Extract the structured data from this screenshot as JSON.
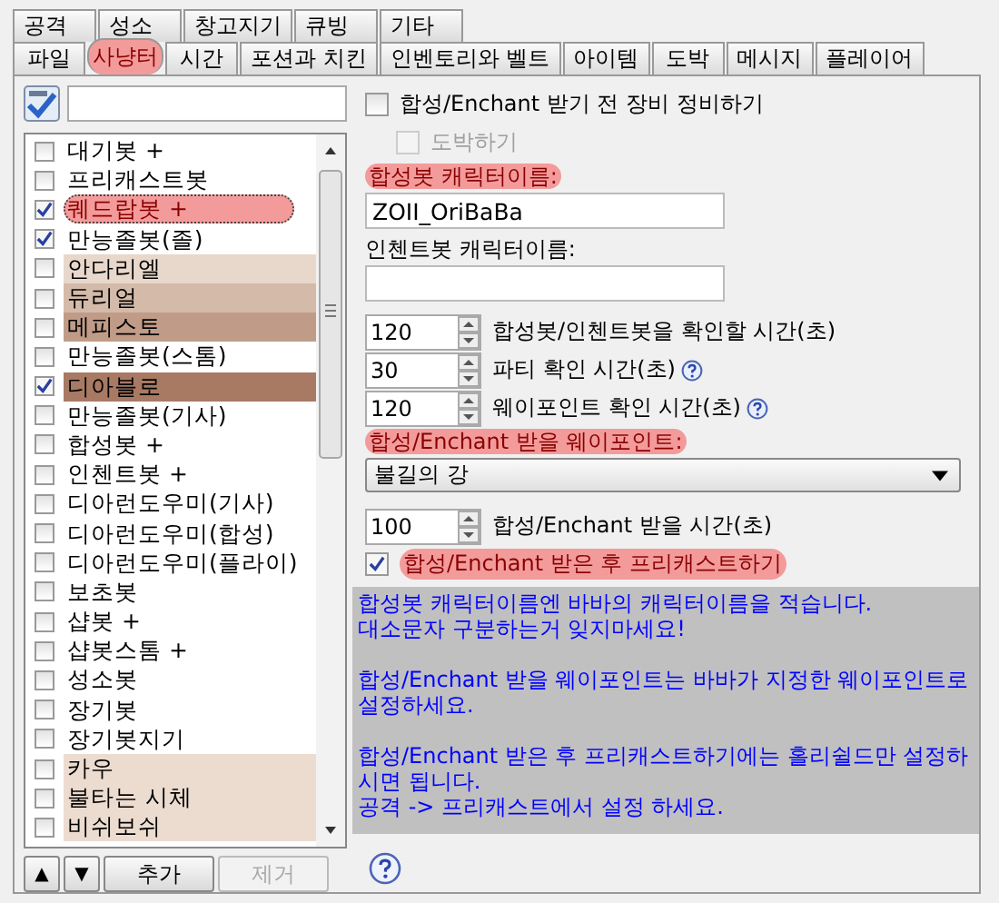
{
  "tabs_back": [
    {
      "label": "공격",
      "selected": false
    },
    {
      "label": "성소",
      "selected": false
    },
    {
      "label": "창고지기",
      "selected": false
    },
    {
      "label": "큐빙",
      "selected": false
    },
    {
      "label": "기타",
      "selected": false
    }
  ],
  "tabs_front": [
    {
      "label": "파일",
      "selected": false,
      "annotated": false
    },
    {
      "label": "사냥터",
      "selected": true,
      "annotated": true
    },
    {
      "label": "시간",
      "selected": false,
      "annotated": false
    },
    {
      "label": "포션과 치킨",
      "selected": false,
      "annotated": false
    },
    {
      "label": "인벤토리와 벨트",
      "selected": false,
      "annotated": false
    },
    {
      "label": "아이템",
      "selected": false,
      "annotated": false
    },
    {
      "label": "도박",
      "selected": false,
      "annotated": false
    },
    {
      "label": "메시지",
      "selected": false,
      "annotated": false
    },
    {
      "label": "플레이어",
      "selected": false,
      "annotated": false
    }
  ],
  "areas": [
    {
      "label": "대기봇 +",
      "checked": false,
      "selected": false,
      "annotated": false
    },
    {
      "label": "프리캐스트봇",
      "checked": false,
      "selected": false,
      "annotated": false
    },
    {
      "label": "퀘드랍봇 +",
      "checked": true,
      "selected": true,
      "annotated": true
    },
    {
      "label": "만능졸봇(졸)",
      "checked": true,
      "selected": false,
      "annotated": false
    },
    {
      "label": "안다리엘",
      "checked": false,
      "selected": false,
      "annotated": false,
      "color": "#e8d8cc"
    },
    {
      "label": "듀리얼",
      "checked": false,
      "selected": false,
      "annotated": false,
      "color": "#d4baa9"
    },
    {
      "label": "메피스토",
      "checked": false,
      "selected": false,
      "annotated": false,
      "color": "#c09c88"
    },
    {
      "label": "만능졸봇(스톰)",
      "checked": false,
      "selected": false,
      "annotated": false
    },
    {
      "label": "디아블로",
      "checked": true,
      "selected": false,
      "annotated": false,
      "color": "#a87a64"
    },
    {
      "label": "만능졸봇(기사)",
      "checked": false,
      "selected": false,
      "annotated": false
    },
    {
      "label": "합성봇 +",
      "checked": false,
      "selected": false,
      "annotated": false
    },
    {
      "label": "인첸트봇 +",
      "checked": false,
      "selected": false,
      "annotated": false
    },
    {
      "label": "디아런도우미(기사)",
      "checked": false,
      "selected": false,
      "annotated": false
    },
    {
      "label": "디아런도우미(합성)",
      "checked": false,
      "selected": false,
      "annotated": false
    },
    {
      "label": "디아런도우미(플라이)",
      "checked": false,
      "selected": false,
      "annotated": false
    },
    {
      "label": "보초봇",
      "checked": false,
      "selected": false,
      "annotated": false
    },
    {
      "label": "샵봇 +",
      "checked": false,
      "selected": false,
      "annotated": false
    },
    {
      "label": "샵봇스톰 +",
      "checked": false,
      "selected": false,
      "annotated": false
    },
    {
      "label": "성소봇",
      "checked": false,
      "selected": false,
      "annotated": false
    },
    {
      "label": "장기봇",
      "checked": false,
      "selected": false,
      "annotated": false
    },
    {
      "label": "장기봇지기",
      "checked": false,
      "selected": false,
      "annotated": false
    },
    {
      "label": "카우",
      "checked": false,
      "selected": false,
      "annotated": false,
      "color": "#ecdcd0"
    },
    {
      "label": "불타는 시체",
      "checked": false,
      "selected": false,
      "annotated": false,
      "color": "#ecdcd0"
    },
    {
      "label": "비쉬보쉬",
      "checked": false,
      "selected": false,
      "annotated": false,
      "color": "#ecdcd0"
    }
  ],
  "list_buttons": {
    "up": "▲",
    "down": "▼",
    "add": "추가",
    "remove": "제거",
    "remove_disabled": true
  },
  "options": {
    "repair": {
      "label": "합성/Enchant 받기 전 장비 정비하기",
      "checked": false
    },
    "gamble": {
      "label": "도박하기",
      "checked": false,
      "disabled": true
    },
    "crafter_label": "합성봇 캐릭터이름:",
    "crafter_label_annotated": true,
    "crafter_value": "ZOII_OriBaBa",
    "enchanter_label": "인첸트봇 캐릭터이름:",
    "enchanter_label_annotated": false,
    "spinners": [
      {
        "value": "120",
        "label": "합성봇/인첸트봇을 확인할 시간(초)",
        "help": false
      },
      {
        "value": "30",
        "label": "파티 확인 시간(초)",
        "help": true
      },
      {
        "value": "120",
        "label": "웨이포인트 확인 시간(초)",
        "help": true
      }
    ],
    "waypoint_label": "합성/Enchant 받을 웨이포인트:",
    "waypoint_label_annotated": true,
    "waypoint": "불길의 강",
    "wait": {
      "value": "100",
      "label": "합성/Enchant 받을 시간(초)"
    },
    "precast": {
      "label": "합성/Enchant 받은 후 프리캐스트하기",
      "checked": true,
      "annotated": true
    }
  },
  "info": [
    [
      "합성봇 캐릭터이름엔 바바의 캐릭터이름을 적습니다.",
      "대소문자 구분하는거 잊지마세요!"
    ],
    [
      "합성/Enchant 받을 웨이포인트는 바바가 지정한 웨이포인트로 설정하세요."
    ],
    [
      "합성/Enchant 받은 후 프리캐스트하기에는 홀리쉴드만 설정하시면 됩니다.",
      "공격 -> 프리캐스트에서 설정 하세요."
    ]
  ]
}
